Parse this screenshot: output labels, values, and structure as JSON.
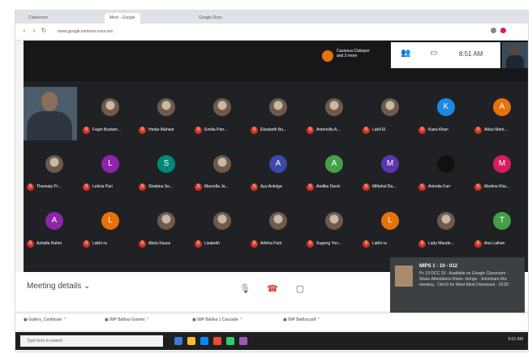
{
  "browser": {
    "tabs": [
      "Classroom",
      "Meet - Google",
      "Google Docs"
    ],
    "url": "meet.google.com/xxx-xxxx-xxx"
  },
  "meet": {
    "presenter": "Cassious Dubayer and 3 more",
    "time": "8:51 AM",
    "tiles": [
      {
        "name": "",
        "type": "camera"
      },
      {
        "name": "Fagin Bustam...",
        "letter": "",
        "color": "pic"
      },
      {
        "name": "Hedar Mahsar",
        "letter": "",
        "color": "pic"
      },
      {
        "name": "Emilia Parr...",
        "letter": "",
        "color": "pic"
      },
      {
        "name": "Elizabeth Bu...",
        "letter": "",
        "color": "pic"
      },
      {
        "name": "Antonella A...",
        "letter": "",
        "color": "pic"
      },
      {
        "name": "Lahil El",
        "letter": "",
        "color": "pic"
      },
      {
        "name": "Kiara Khan",
        "letter": "K",
        "color": "#1e88e5"
      },
      {
        "name": "Alicia Mont...",
        "letter": "A",
        "color": "#e8710a"
      },
      {
        "name": "Thessaly Pr...",
        "letter": "",
        "color": "pic"
      },
      {
        "name": "Leticia Pari",
        "letter": "L",
        "color": "#8e24aa"
      },
      {
        "name": "Shabina Se...",
        "letter": "S",
        "color": "#00897b"
      },
      {
        "name": "Marcella Ja...",
        "letter": "",
        "color": "pic"
      },
      {
        "name": "Ayu Antelga",
        "letter": "A",
        "color": "#3949ab"
      },
      {
        "name": "Andika Davin",
        "letter": "A",
        "color": "#43a047"
      },
      {
        "name": "Miftahul Ra...",
        "letter": "M",
        "color": "#5e35b1"
      },
      {
        "name": "Anindia Farr",
        "letter": "",
        "color": "#111111"
      },
      {
        "name": "Martina Kha...",
        "letter": "M",
        "color": "#d81b60"
      },
      {
        "name": "Azhalla Rahm",
        "letter": "A",
        "color": "#8e24aa"
      },
      {
        "name": "Lakhi ra",
        "letter": "L",
        "color": "#e8710a"
      },
      {
        "name": "Alicia Kauss",
        "letter": "",
        "color": "pic"
      },
      {
        "name": "Lisabeth",
        "letter": "",
        "color": "pic"
      },
      {
        "name": "Arfeha Putri",
        "letter": "",
        "color": "pic"
      },
      {
        "name": "Sugeng Yon...",
        "letter": "",
        "color": "pic"
      },
      {
        "name": "Lakhi ra",
        "letter": "L",
        "color": "#e8710a"
      },
      {
        "name": "Lady Maude...",
        "letter": "",
        "color": "pic"
      },
      {
        "name": "Ana Lathan",
        "letter": "T",
        "color": "#43a047"
      }
    ],
    "meeting_details_label": "Meeting details"
  },
  "notification": {
    "title": "MIPS 1 - 10 - 012",
    "body": "Pc 10 OCC 10 · Available on Google Classroom - Share Attendance Rows: strings · Join/share this meeting · Ctrl+D for Meet Meet Dismissed · 10:02"
  },
  "downloads": [
    "Gallery_Certificate",
    "IMP Balfour Games",
    "IMP Ballina 1 Cascade",
    "IMP Balfour.pdf"
  ],
  "taskbar": {
    "search_placeholder": "Type here to search",
    "clock": "9:01 AM"
  }
}
